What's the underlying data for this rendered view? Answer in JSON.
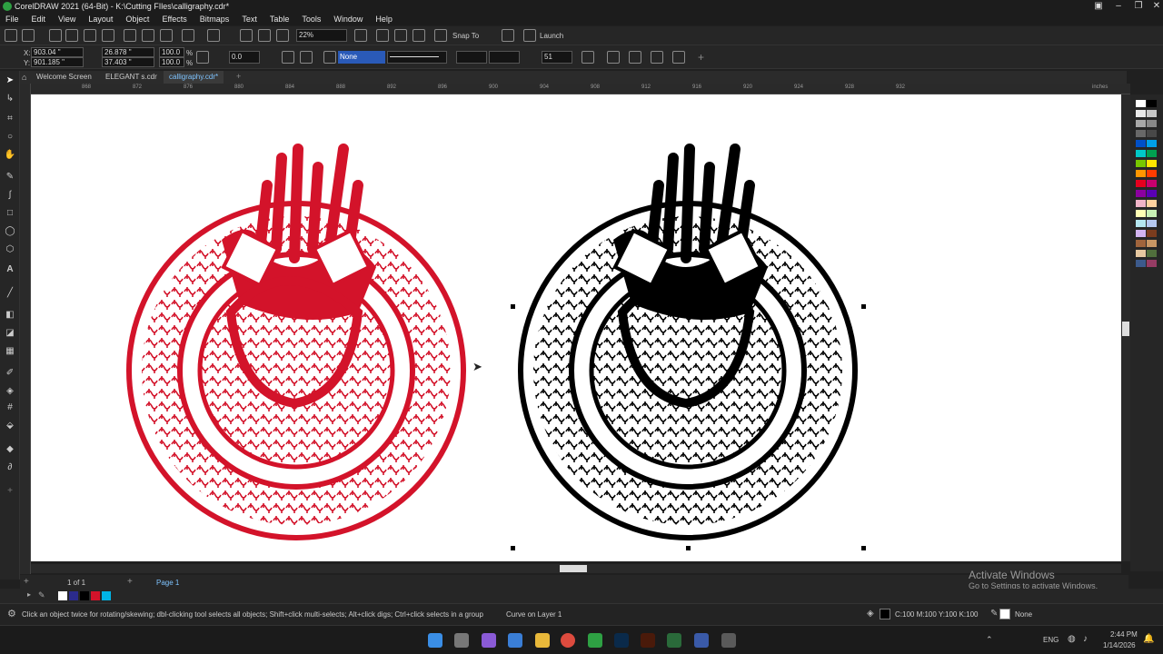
{
  "window": {
    "title": "CorelDRAW 2021 (64-Bit) - K:\\Cutting FIles\\calligraphy.cdr*"
  },
  "menu": [
    "File",
    "Edit",
    "View",
    "Layout",
    "Object",
    "Effects",
    "Bitmaps",
    "Text",
    "Table",
    "Tools",
    "Window",
    "Help"
  ],
  "standard": {
    "zoom": "22%",
    "snap": "Snap To",
    "launch": "Launch"
  },
  "property": {
    "x": "903.04 \"",
    "y": "901.185 \"",
    "w": "26.878 \"",
    "h": "37.403 \"",
    "scale_w": "100.0",
    "scale_h": "100.0",
    "pct": "%",
    "angle": "0.0",
    "outline": "None",
    "nodes": "51"
  },
  "tabs": [
    "Welcome Screen",
    "ELEGANT s.cdr",
    "calligraphy.cdr*"
  ],
  "ruler": {
    "h": [
      "868",
      "872",
      "876",
      "880",
      "884",
      "888",
      "892",
      "896",
      "900",
      "904",
      "908",
      "912",
      "916",
      "920",
      "924",
      "928",
      "932"
    ],
    "unit": "inches"
  },
  "canvas": {
    "red_color": "#d3132a",
    "black_color": "#000000"
  },
  "page": {
    "counter": "1 of 1",
    "name": "Page 1"
  },
  "status": {
    "hint": "Click an object twice for rotating/skewing; dbl-clicking tool selects all objects; Shift+click multi-selects; Alt+click digs; Ctrl+click selects in a group",
    "object": "Curve on Layer 1",
    "color": "C:100 M:100 Y:100 K:100",
    "outline": "None"
  },
  "watermark": {
    "title": "Activate Windows",
    "sub": "Go to Settings to activate Windows."
  },
  "taskbar": {
    "lang": "ENG",
    "time": "2:44 PM",
    "date": "1/14/2026"
  },
  "palette": [
    "#ffffff",
    "#000000",
    "#e8e8e8",
    "#c8c8c8",
    "#a8a8a8",
    "#888888",
    "#686868",
    "#484848",
    "#0050c8",
    "#00a0e8",
    "#00c8c8",
    "#00a050",
    "#78c800",
    "#ffe600",
    "#ff9600",
    "#ff3c00",
    "#e6001e",
    "#c8006e",
    "#8c00a0",
    "#5a00b4",
    "#f0b4c8",
    "#ffd2a0",
    "#ffffb4",
    "#c8f0b4",
    "#b4e6f0",
    "#b4c8f0",
    "#d2b4f0",
    "#7a3c1e",
    "#a0643c",
    "#c89664",
    "#e6c8a0",
    "#506e3c",
    "#3c5a8c",
    "#963c64"
  ]
}
